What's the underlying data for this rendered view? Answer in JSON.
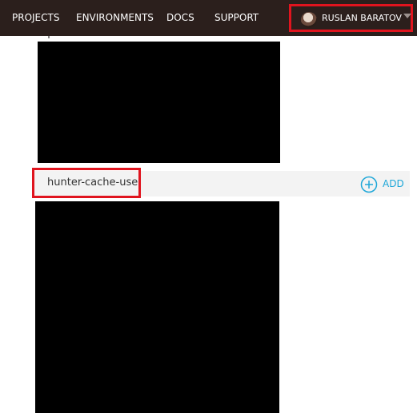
{
  "nav": {
    "items": [
      {
        "label": "PROJECTS"
      },
      {
        "label": "ENVIRONMENTS"
      },
      {
        "label": "DOCS"
      },
      {
        "label": "SUPPORT"
      }
    ],
    "user": {
      "name": "RUSLAN BARATOV",
      "avatar_icon": "user-avatar",
      "menu_icon": "chevron-down-icon"
    }
  },
  "row": {
    "name": "hunter-cache-use",
    "add_label": "ADD",
    "add_icon": "plus-circle-icon"
  },
  "colors": {
    "topbar": "#2b1f1c",
    "highlight": "#e0141e",
    "accent": "#1ea7d8"
  }
}
